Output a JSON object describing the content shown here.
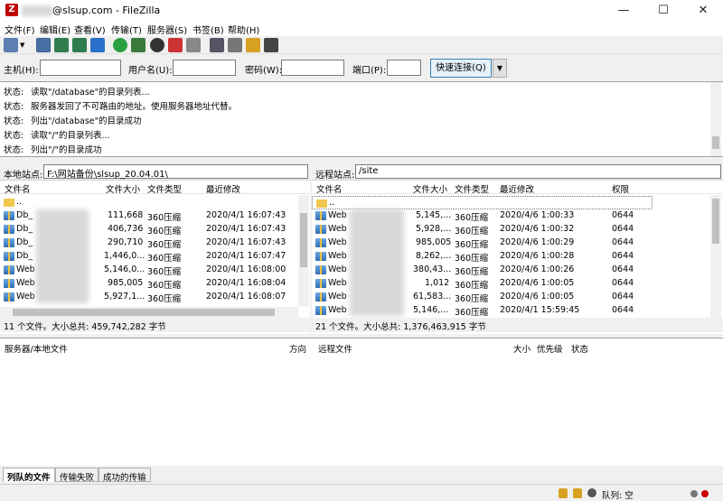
{
  "window": {
    "title": "@slsup.com - FileZilla",
    "minimize": "—",
    "maximize": "☐",
    "close": "✕"
  },
  "menu": [
    "文件(F)",
    "编辑(E)",
    "查看(V)",
    "传输(T)",
    "服务器(S)",
    "书签(B)",
    "帮助(H)"
  ],
  "quickconnect": {
    "host_label": "主机(H):",
    "user_label": "用户名(U):",
    "pass_label": "密码(W):",
    "port_label": "端口(P):",
    "button": "快速连接(Q)",
    "dropdown": "▼"
  },
  "log": [
    {
      "k": "状态:",
      "v": "读取\"/database\"的目录列表..."
    },
    {
      "k": "状态:",
      "v": "服务器发回了不可路由的地址。使用服务器地址代替。"
    },
    {
      "k": "状态:",
      "v": "列出\"/database\"的目录成功"
    },
    {
      "k": "状态:",
      "v": "读取\"/\"的目录列表..."
    },
    {
      "k": "状态:",
      "v": "列出\"/\"的目录成功"
    }
  ],
  "local": {
    "label": "本地站点:",
    "path": "F:\\网站备份\\slsup_20.04.01\\",
    "headers": [
      "文件名",
      "文件大小",
      "文件类型",
      "最近修改"
    ],
    "rows": [
      {
        "name": "..",
        "size": "",
        "type": "",
        "mod": ""
      },
      {
        "name": "Db_",
        "size": "111,668",
        "type": "360压缩",
        "mod": "2020/4/1 16:07:43"
      },
      {
        "name": "Db_",
        "size": "406,736",
        "type": "360压缩",
        "mod": "2020/4/1 16:07:43"
      },
      {
        "name": "Db_",
        "size": "290,710",
        "type": "360压缩",
        "mod": "2020/4/1 16:07:43"
      },
      {
        "name": "Db_",
        "size": "1,446,0...",
        "type": "360压缩",
        "mod": "2020/4/1 16:07:47"
      },
      {
        "name": "Web",
        "size": "5,146,0...",
        "type": "360压缩",
        "mod": "2020/4/1 16:08:00"
      },
      {
        "name": "Web",
        "size": "985,005",
        "type": "360压缩",
        "mod": "2020/4/1 16:08:04"
      },
      {
        "name": "Web",
        "size": "5,927,1...",
        "type": "360压缩",
        "mod": "2020/4/1 16:08:07"
      }
    ],
    "status": "11 个文件。大小总共: 459,742,282 字节"
  },
  "remote": {
    "label": "远程站点:",
    "path": "/site",
    "headers": [
      "文件名",
      "文件大小",
      "文件类型",
      "最近修改",
      "权限"
    ],
    "rows": [
      {
        "name": "..",
        "size": "",
        "type": "",
        "mod": "",
        "perm": ""
      },
      {
        "name": "Web",
        "size": "5,145,...",
        "type": "360压缩",
        "mod": "2020/4/6 1:00:33",
        "perm": "0644"
      },
      {
        "name": "Web",
        "size": "5,928,...",
        "type": "360压缩",
        "mod": "2020/4/6 1:00:32",
        "perm": "0644"
      },
      {
        "name": "Web",
        "size": "985,005",
        "type": "360压缩",
        "mod": "2020/4/6 1:00:29",
        "perm": "0644"
      },
      {
        "name": "Web",
        "size": "8,262,...",
        "type": "360压缩",
        "mod": "2020/4/6 1:00:28",
        "perm": "0644"
      },
      {
        "name": "Web",
        "size": "380,43...",
        "type": "360压缩",
        "mod": "2020/4/6 1:00:26",
        "perm": "0644"
      },
      {
        "name": "Web",
        "size": "1,012",
        "type": "360压缩",
        "mod": "2020/4/6 1:00:05",
        "perm": "0644"
      },
      {
        "name": "Web",
        "size": "61,583...",
        "type": "360压缩",
        "mod": "2020/4/6 1:00:05",
        "perm": "0644"
      },
      {
        "name": "Web",
        "size": "5,146,...",
        "type": "360压缩",
        "mod": "2020/4/1 15:59:45",
        "perm": "0644"
      }
    ],
    "status": "21 个文件。大小总共: 1,376,463,915 字节"
  },
  "queue": {
    "headers": [
      "服务器/本地文件",
      "方向",
      "远程文件",
      "大小",
      "优先级",
      "状态"
    ]
  },
  "tabs": [
    "列队的文件",
    "传输失败",
    "成功的传输"
  ],
  "statusbar": {
    "queue": "队列: 空"
  }
}
